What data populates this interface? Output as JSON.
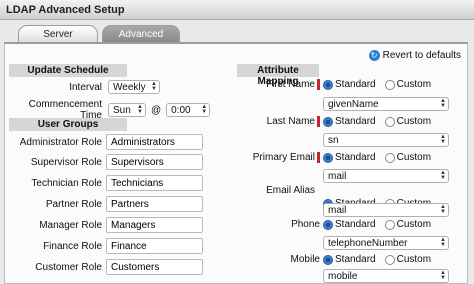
{
  "window": {
    "title": "LDAP Advanced Setup"
  },
  "tabs": [
    {
      "label": "Server"
    },
    {
      "label": "Advanced"
    }
  ],
  "revert": {
    "label": "Revert to defaults",
    "icon": "revert-icon"
  },
  "update_schedule": {
    "heading": "Update Schedule",
    "interval_label": "Interval",
    "interval_value": "Weekly",
    "commencement_label": "Commencement Time",
    "day_value": "Sun",
    "at_symbol": "@",
    "time_value": "0:00"
  },
  "user_groups": {
    "heading": "User Groups",
    "roles": [
      {
        "label": "Administrator Role",
        "value": "Administrators"
      },
      {
        "label": "Supervisor Role",
        "value": "Supervisors"
      },
      {
        "label": "Technician Role",
        "value": "Technicians"
      },
      {
        "label": "Partner Role",
        "value": "Partners"
      },
      {
        "label": "Manager Role",
        "value": "Managers"
      },
      {
        "label": "Finance Role",
        "value": "Finance"
      },
      {
        "label": "Customer Role",
        "value": "Customers"
      }
    ]
  },
  "attribute_mapping": {
    "heading": "Attribute Mapping",
    "standard_label": "Standard",
    "custom_label": "Custom",
    "fields": [
      {
        "label": "First Name",
        "required": true,
        "value": "givenName"
      },
      {
        "label": "Last Name",
        "required": true,
        "value": "sn"
      },
      {
        "label": "Primary Email",
        "required": true,
        "value": "mail"
      },
      {
        "label": "Email Alias",
        "required": false,
        "value": "mail"
      },
      {
        "label": "Phone",
        "required": false,
        "value": "telephoneNumber"
      },
      {
        "label": "Mobile",
        "required": false,
        "value": "mobile"
      }
    ]
  },
  "colors": {
    "required_marker": "#c0282d",
    "radio_selected": "#2a6ac2",
    "section_header": "#d6d6d6"
  }
}
